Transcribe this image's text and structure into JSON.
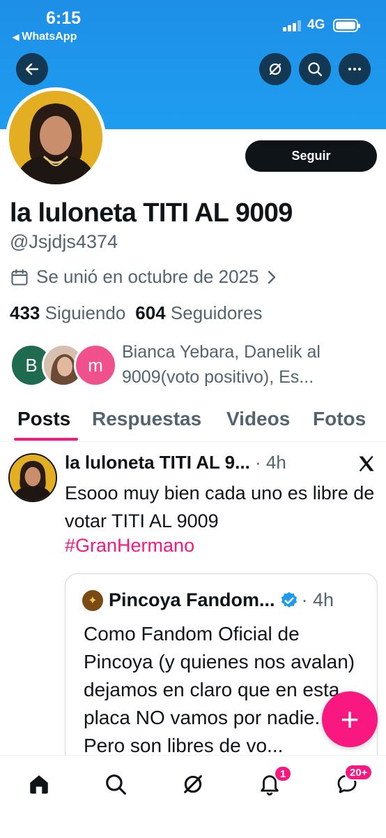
{
  "status": {
    "time": "6:15",
    "back_app": "WhatsApp",
    "network": "4G",
    "back_arrow": "◀"
  },
  "header": {
    "back_icon": "arrow-left-icon",
    "grok_icon": "grok-icon",
    "search_icon": "search-icon",
    "more_icon": "more-icon"
  },
  "profile": {
    "name": "la luloneta TITI AL 9009",
    "handle": "@Jsjdjs4374",
    "joined": "Se unió en octubre de 2025",
    "following_count": "433",
    "following_label": "Siguiendo",
    "followers_count": "604",
    "followers_label": "Seguidores",
    "follow_button": "Seguir",
    "mutuals_text": "Bianca Yebara, Danelik al 9009(voto positivo), Es...",
    "facepile": [
      {
        "letter": "B",
        "color": "#1f6b4f"
      },
      {
        "letter": "",
        "color": "#c9a08a"
      },
      {
        "letter": "m",
        "color": "#f0508c"
      }
    ]
  },
  "tabs": [
    {
      "label": "Posts",
      "active": true
    },
    {
      "label": "Respuestas",
      "active": false
    },
    {
      "label": "Videos",
      "active": false
    },
    {
      "label": "Fotos",
      "active": false
    }
  ],
  "post": {
    "author": "la luloneta TITI AL 9...",
    "meta": " · 4h",
    "text": "Esooo muy bien cada uno es libre de votar TITI AL 9009",
    "hashtag": "#GranHermano",
    "quote": {
      "author": "Pincoya Fandom...",
      "meta": " · 4h",
      "text": "Como Fandom Oficial de Pincoya (y quienes nos avalan) dejamos en claro que en esta placa NO vamos por nadie. Pero son libres de vo..."
    }
  },
  "fab": {
    "label": "+"
  },
  "bottom_nav": {
    "items": [
      "home-icon",
      "search-icon",
      "grok-icon",
      "notifications-icon",
      "messages-icon"
    ],
    "notifications_badge": "1",
    "messages_badge": "20+"
  },
  "colors": {
    "accent": "#f91880",
    "banner": "#1d9bf0",
    "text": "#0f1419",
    "muted": "#536471"
  }
}
